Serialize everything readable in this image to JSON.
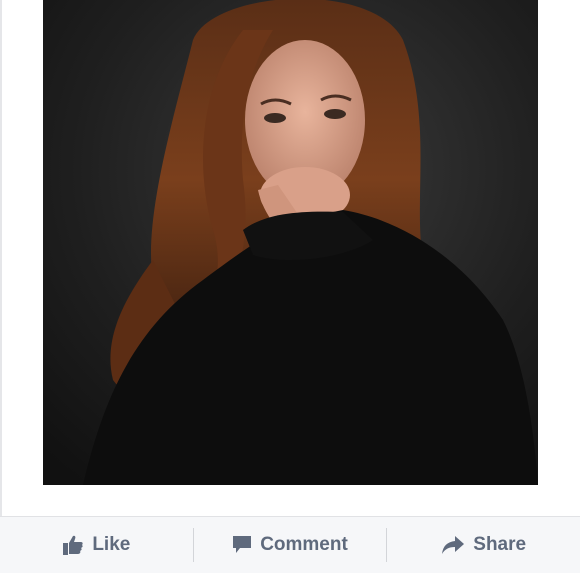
{
  "post": {
    "photo_alt": "Portrait photo",
    "actions": {
      "like_label": "Like",
      "comment_label": "Comment",
      "share_label": "Share"
    }
  },
  "icons": {
    "like": "thumbs-up-icon",
    "comment": "comment-icon",
    "share": "share-arrow-icon"
  },
  "colors": {
    "action_text": "#5f6a7d",
    "action_bar_bg": "#f6f7f9"
  }
}
